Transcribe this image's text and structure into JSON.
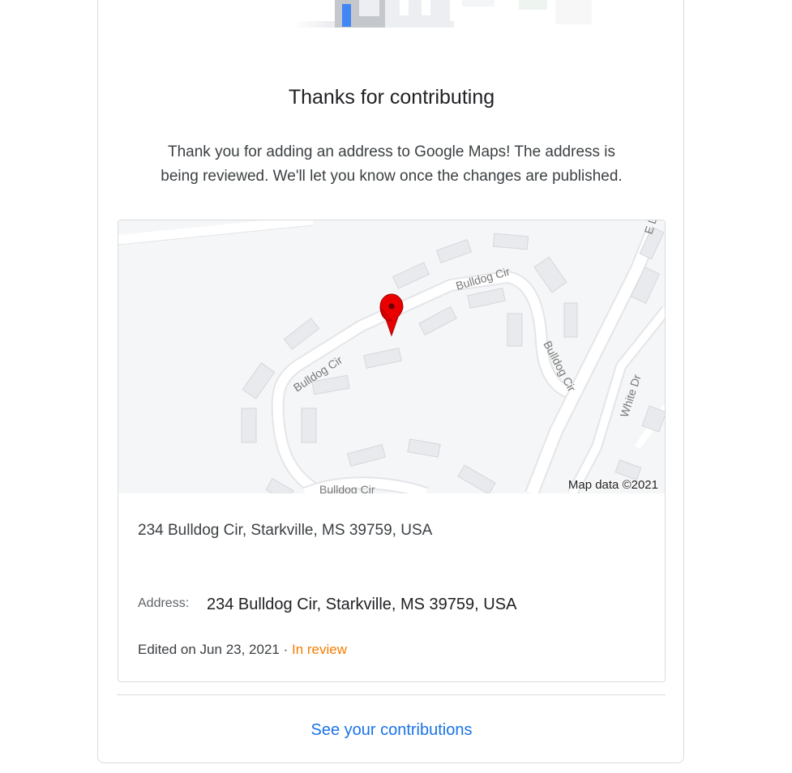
{
  "confirmation": {
    "title": "Thanks for contributing",
    "message_line1": "Thank you for adding an address to Google Maps! The address is",
    "message_line2": "being reviewed. We'll let you know once the changes are published."
  },
  "map": {
    "attribution": "Map data ©2021",
    "street_labels": [
      "Bulldog Cir",
      "Bulldog Cir",
      "Bulldog Cir",
      "Bulldog Cir",
      "White Dr",
      "E L"
    ],
    "marker_icon": "red-map-pin-icon",
    "background_color": "#f5f6f7",
    "road_color": "#ffffff",
    "building_color": "#e8eaed",
    "marker_color": "#ea0000"
  },
  "place": {
    "name": "234 Bulldog Cir, Starkville, MS 39759, USA",
    "address_label": "Address:",
    "address_value": "234 Bulldog Cir, Starkville, MS 39759, USA",
    "edited_text": "Edited on Jun 23, 2021 · ",
    "status_text": "In review",
    "status_color": "#f57c00"
  },
  "footer": {
    "link_label": "See your contributions",
    "link_color": "#1a73e8"
  }
}
